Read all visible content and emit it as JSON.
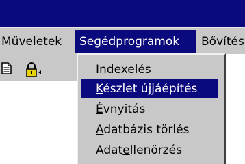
{
  "menubar": {
    "items": [
      {
        "pre": "",
        "u": "M",
        "post": "űveletek"
      },
      {
        "pre": "Segéd",
        "u": "p",
        "post": "rogramok"
      },
      {
        "pre": "",
        "u": "B",
        "post": "ővítés"
      }
    ],
    "active_index": 1
  },
  "toolbar": {
    "icons": [
      "document-icon",
      "lock-icon"
    ]
  },
  "dropdown": {
    "items": [
      {
        "pre": "",
        "u": "I",
        "post": "ndexelés"
      },
      {
        "pre": "",
        "u": "K",
        "post": "észlet újjáépítés"
      },
      {
        "pre": "",
        "u": "É",
        "post": "vnyitás"
      },
      {
        "pre": "",
        "u": "A",
        "post": "datbázis törlés"
      },
      {
        "pre": "Adat",
        "u": "e",
        "post": "llenörzés"
      }
    ],
    "selected_index": 1
  },
  "colors": {
    "highlight": "#0a0a7e",
    "menu_bg": "#c8c8c8"
  }
}
